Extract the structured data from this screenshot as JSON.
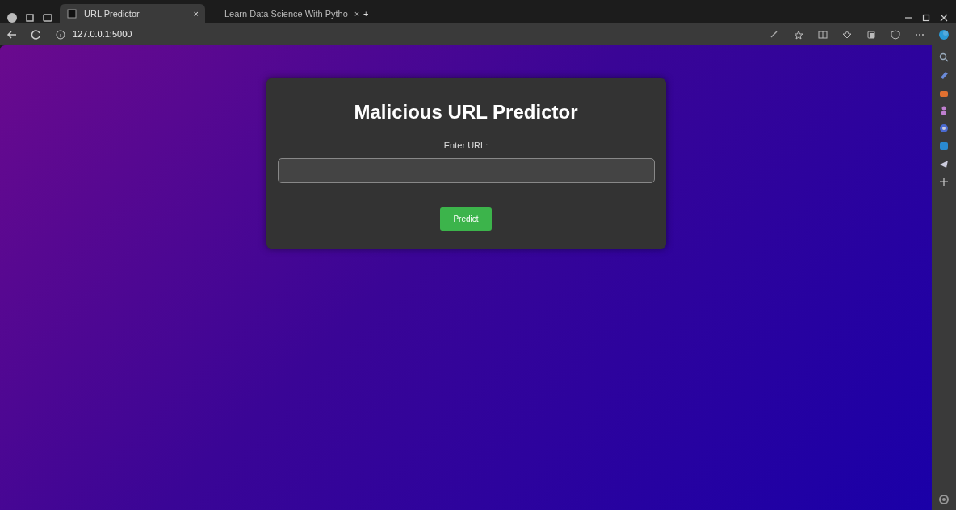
{
  "browser": {
    "tabs": [
      {
        "title": "URL Predictor",
        "selected": true,
        "close": "×"
      },
      {
        "title": "Learn Data Science With Pytho",
        "selected": false,
        "close": "×"
      }
    ],
    "new_tab": "+",
    "address": "127.0.0.1:5000"
  },
  "page": {
    "title": "Malicious URL Predictor",
    "label": "Enter URL:",
    "button": "Predict"
  }
}
